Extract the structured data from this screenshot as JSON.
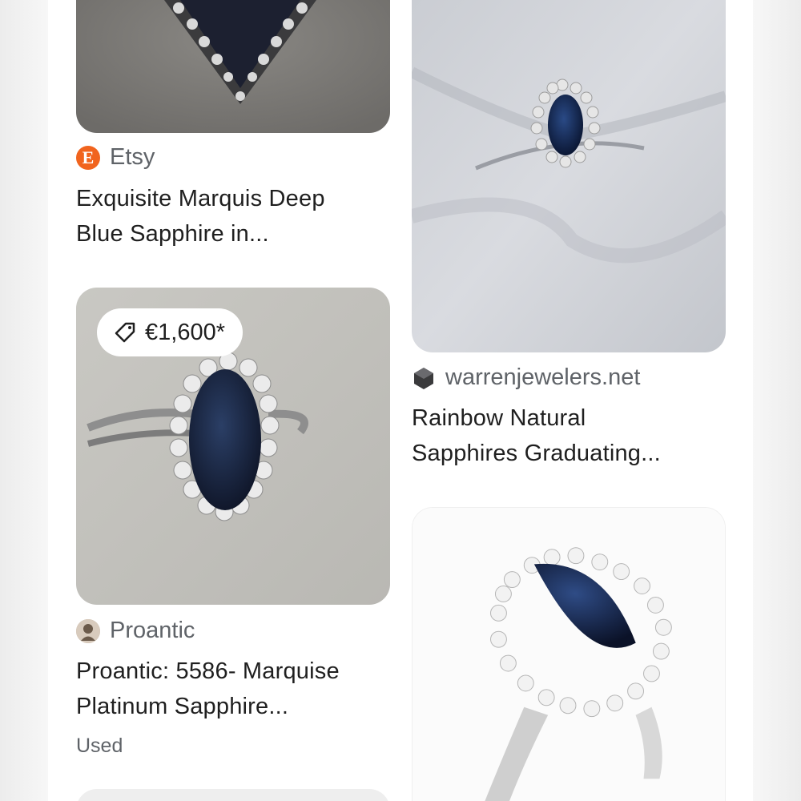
{
  "results": [
    {
      "source": "Etsy",
      "source_icon": "etsy-logo-icon",
      "source_icon_letter": "E",
      "source_icon_color": "#f1641e",
      "title_line1": "Exquisite Marquis Deep",
      "title_line2": "Blue Sapphire in..."
    },
    {
      "source": "warrenjewelers.net",
      "source_icon": "warrenjewelers-logo-icon",
      "title_line1": "Rainbow Natural",
      "title_line2": "Sapphires Graduating..."
    },
    {
      "price": "€1,600*",
      "price_icon": "price-tag-icon",
      "source": "Proantic",
      "source_icon": "proantic-logo-icon",
      "title_line1": "Proantic: 5586- Marquise",
      "title_line2": "Platinum Sapphire...",
      "condition": "Used"
    }
  ]
}
